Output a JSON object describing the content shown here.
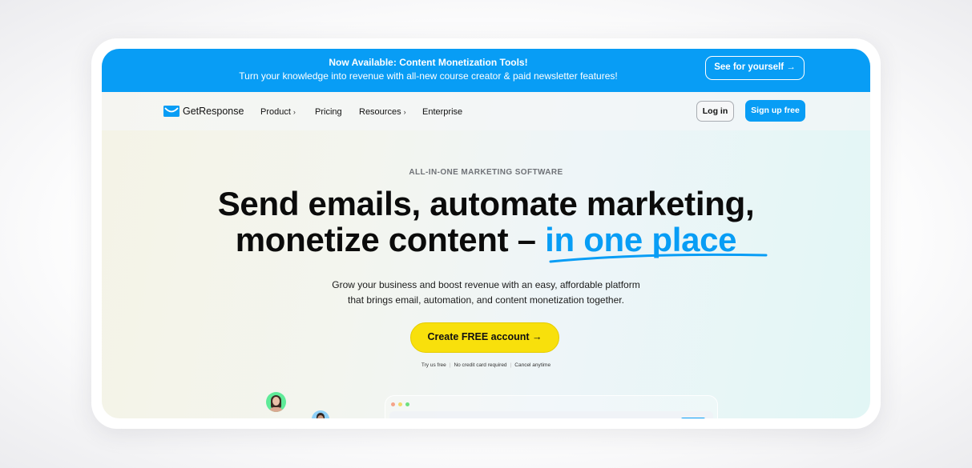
{
  "banner": {
    "title": "Now Available: Content Monetization Tools!",
    "subtitle": "Turn your knowledge into revenue with all-new course creator & paid newsletter features!",
    "cta_label": "See for yourself →"
  },
  "nav": {
    "logo_text": "GetResponse",
    "items": [
      {
        "label": "Product",
        "has_chevron": true
      },
      {
        "label": "Pricing",
        "has_chevron": false
      },
      {
        "label": "Resources",
        "has_chevron": true
      },
      {
        "label": "Enterprise",
        "has_chevron": false
      }
    ],
    "chevron": "›",
    "login_label": "Log in",
    "signup_label": "Sign up free"
  },
  "hero": {
    "eyebrow": "ALL-IN-ONE MARKETING SOFTWARE",
    "headline_line1": "Send emails, automate marketing,",
    "headline_line2_prefix": "monetize content – ",
    "headline_accent": "in one place",
    "description_line1": "Grow your business and boost revenue with an easy, affordable platform",
    "description_line2": "that brings email, automation, and content monetization together.",
    "cta_label": "Create FREE account →",
    "fineprint": [
      "Try us free",
      "No credit card required",
      "Cancel anytime"
    ]
  },
  "colors": {
    "brand_blue": "#089df5",
    "cta_yellow": "#f8e00c",
    "window_dots": [
      "#f5a48a",
      "#f3d86a",
      "#6ee07e"
    ]
  }
}
